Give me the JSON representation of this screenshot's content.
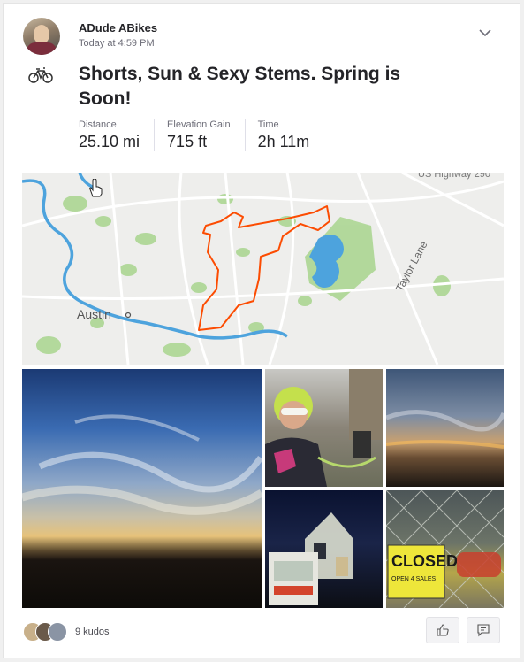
{
  "athlete": {
    "name": "ADude ABikes",
    "timestamp": "Today at 4:59 PM"
  },
  "activity": {
    "title": "Shorts, Sun & Sexy Stems. Spring is Soon!",
    "type_icon": "bicycle-icon",
    "stats": [
      {
        "label": "Distance",
        "value": "25.10 mi"
      },
      {
        "label": "Elevation Gain",
        "value": "715 ft"
      },
      {
        "label": "Time",
        "value": "2h 11m"
      }
    ]
  },
  "map": {
    "labels": {
      "city": "Austin",
      "road": "Taylor Lane",
      "highway": "US Highway 290"
    },
    "colors": {
      "route": "#fc4c02",
      "water": "#4da3dd",
      "park": "#a8d58e",
      "base": "#eeeeec"
    }
  },
  "photos": [
    "sunset-clouds",
    "rider-selfie",
    "sunset-sky",
    "night-building",
    "closed-sign"
  ],
  "photo_signs": {
    "closed": "CLOSED",
    "open_sales": "OPEN 4 SALES"
  },
  "kudos": {
    "count_text": "9 kudos"
  },
  "actions": {
    "kudos_icon": "thumbs-up-icon",
    "comment_icon": "comment-icon"
  }
}
